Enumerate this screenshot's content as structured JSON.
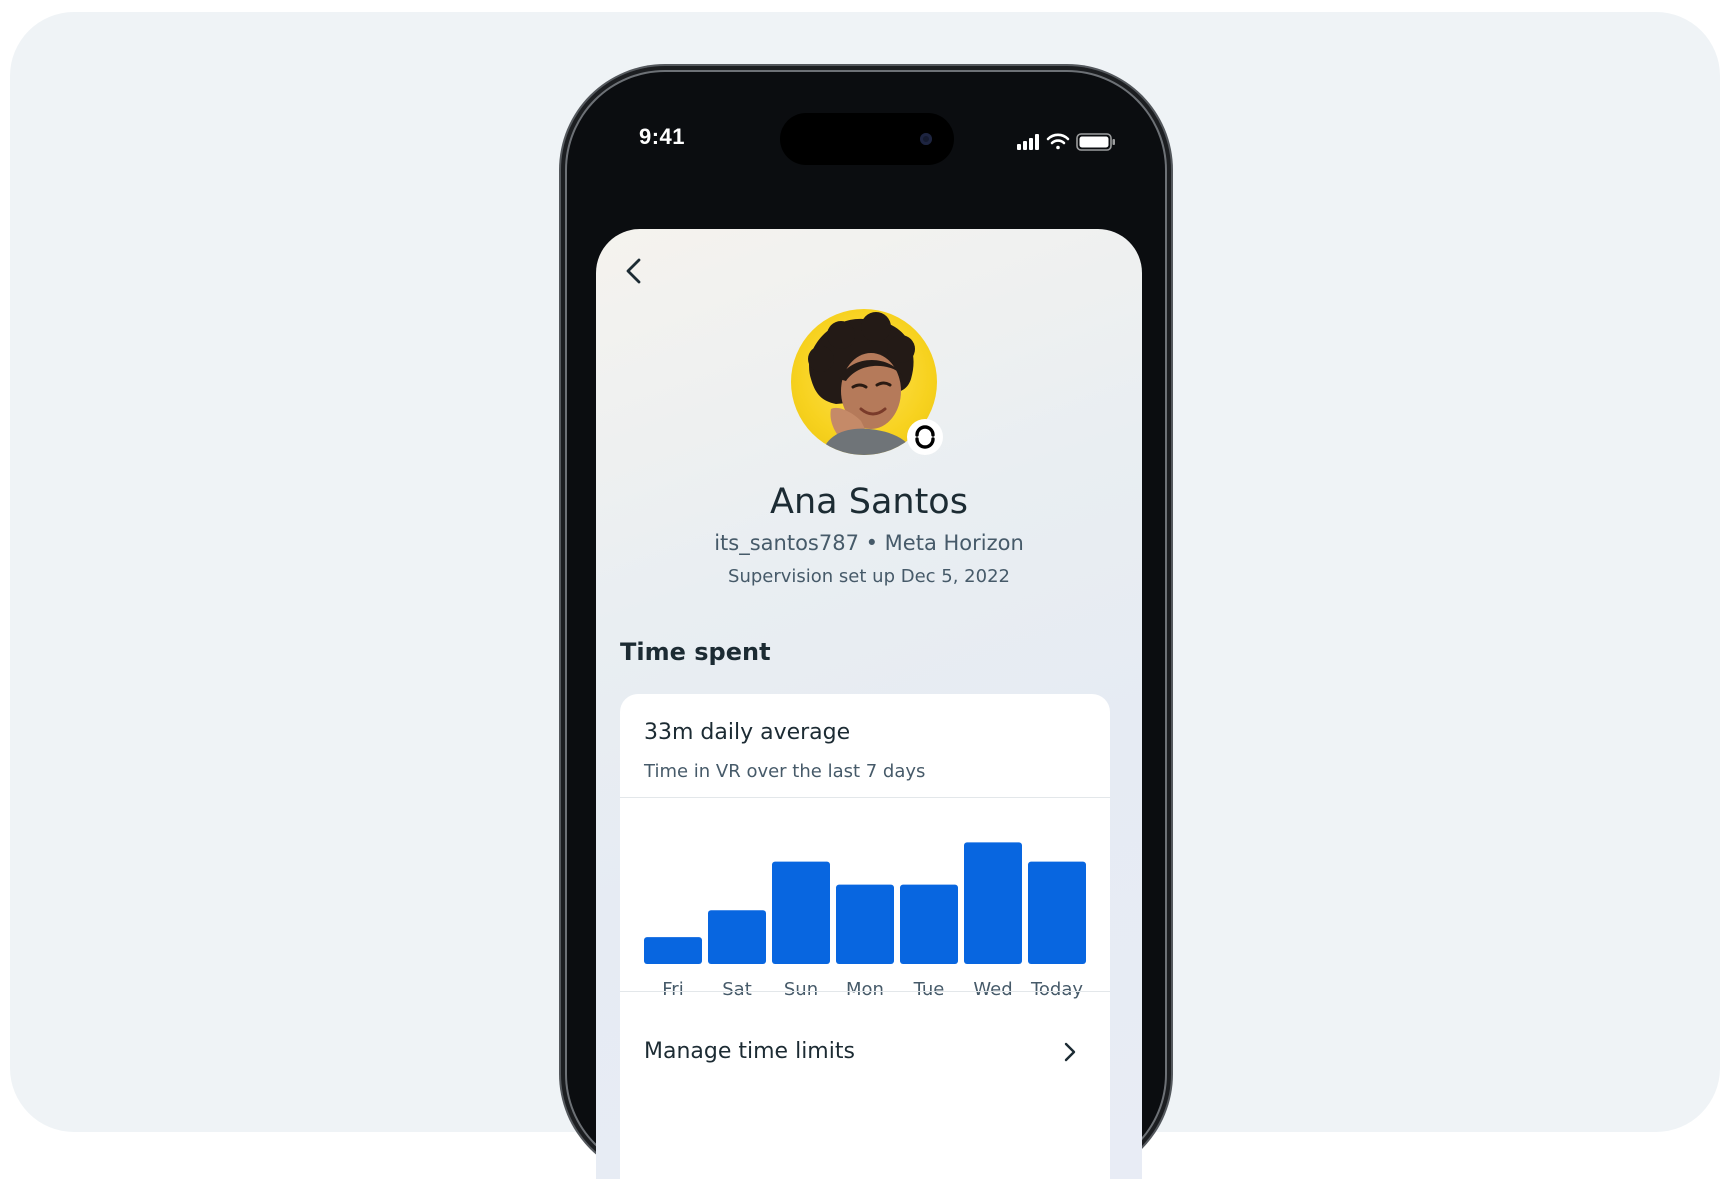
{
  "status_bar": {
    "time": "9:41"
  },
  "profile": {
    "name": "Ana Santos",
    "handle_line": "its_santos787 • Meta Horizon",
    "supervision": "Supervision set up Dec 5, 2022"
  },
  "time_spent": {
    "section_title": "Time spent",
    "average": "33m daily average",
    "subtitle": "Time in VR over the last 7 days",
    "manage_label": "Manage time limits"
  },
  "chart_data": {
    "type": "bar",
    "categories": [
      "Fri",
      "Sat",
      "Sun",
      "Mon",
      "Tue",
      "Wed",
      "Today"
    ],
    "values": [
      21,
      42,
      80,
      62,
      62,
      95,
      80
    ],
    "ylim": [
      0,
      100
    ],
    "grid": false,
    "bar_color": "#0866e0"
  },
  "colors": {
    "accent": "#0866e0",
    "text": "#1c2b33",
    "secondary": "#465a69"
  },
  "icons": {
    "back": "chevron-left-icon",
    "badge": "meta-sync-icon",
    "manage": "chevron-right-icon"
  }
}
